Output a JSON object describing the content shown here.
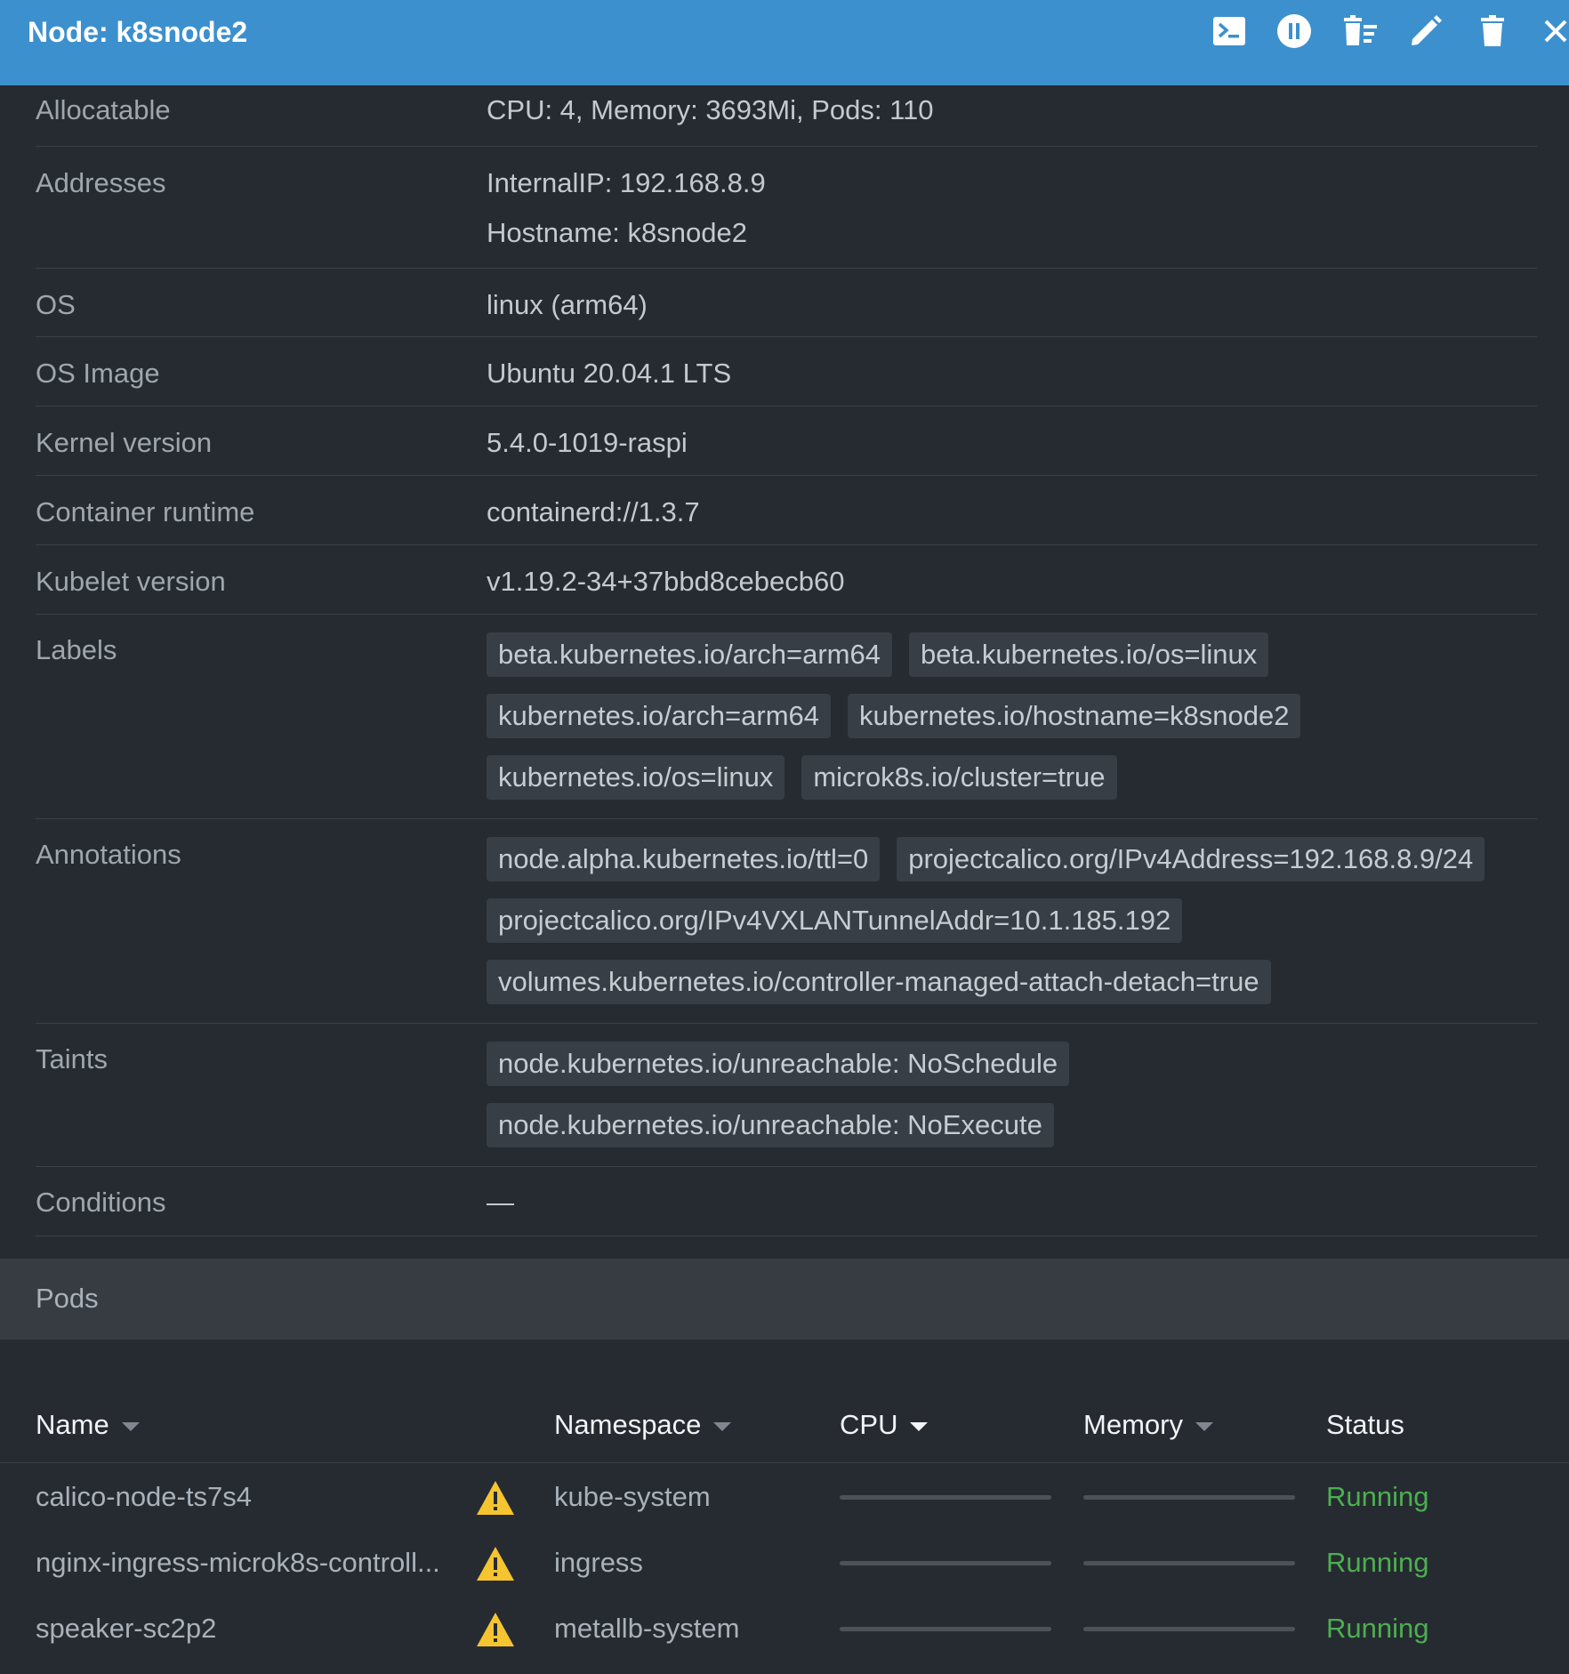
{
  "header": {
    "title": "Node: k8snode2",
    "icons": [
      "terminal-icon",
      "pause-icon",
      "drain-icon",
      "edit-icon",
      "trash-icon",
      "close-icon"
    ]
  },
  "details": {
    "allocatable": {
      "label": "Allocatable",
      "value": "CPU: 4, Memory: 3693Mi, Pods: 110"
    },
    "addresses": {
      "label": "Addresses",
      "internal_ip": "InternalIP: 192.168.8.9",
      "hostname": "Hostname: k8snode2"
    },
    "os": {
      "label": "OS",
      "value": "linux (arm64)"
    },
    "os_image": {
      "label": "OS Image",
      "value": "Ubuntu 20.04.1 LTS"
    },
    "kernel": {
      "label": "Kernel version",
      "value": "5.4.0-1019-raspi"
    },
    "runtime": {
      "label": "Container runtime",
      "value": "containerd://1.3.7"
    },
    "kubelet": {
      "label": "Kubelet version",
      "value": "v1.19.2-34+37bbd8cebecb60"
    },
    "labels": {
      "label": "Labels",
      "items": [
        "beta.kubernetes.io/arch=arm64",
        "beta.kubernetes.io/os=linux",
        "kubernetes.io/arch=arm64",
        "kubernetes.io/hostname=k8snode2",
        "kubernetes.io/os=linux",
        "microk8s.io/cluster=true"
      ]
    },
    "annotations": {
      "label": "Annotations",
      "items": [
        "node.alpha.kubernetes.io/ttl=0",
        "projectcalico.org/IPv4Address=192.168.8.9/24",
        "projectcalico.org/IPv4VXLANTunnelAddr=10.1.185.192",
        "volumes.kubernetes.io/controller-managed-attach-detach=true"
      ]
    },
    "taints": {
      "label": "Taints",
      "items": [
        "node.kubernetes.io/unreachable: NoSchedule",
        "node.kubernetes.io/unreachable: NoExecute"
      ]
    },
    "conditions": {
      "label": "Conditions",
      "value": "—"
    }
  },
  "pods": {
    "title": "Pods",
    "columns": {
      "name": "Name",
      "namespace": "Namespace",
      "cpu": "CPU",
      "memory": "Memory",
      "status": "Status"
    },
    "rows": [
      {
        "name": "calico-node-ts7s4",
        "namespace": "kube-system",
        "status": "Running"
      },
      {
        "name": "nginx-ingress-microk8s-controll...",
        "namespace": "ingress",
        "status": "Running"
      },
      {
        "name": "speaker-sc2p2",
        "namespace": "metallb-system",
        "status": "Running"
      }
    ]
  },
  "colors": {
    "header_bg": "#3d90ce",
    "page_bg": "#262b31",
    "status_running": "#4caf50",
    "warning": "#f5c430"
  }
}
